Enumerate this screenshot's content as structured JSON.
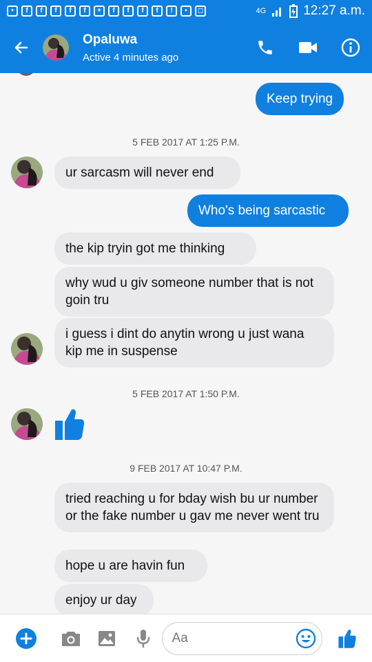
{
  "status_bar": {
    "network": "4G",
    "time": "12:27 a.m."
  },
  "header": {
    "name": "Opaluwa",
    "status": "Active 4 minutes ago"
  },
  "messages": [
    {
      "text": "Keep trying"
    },
    {
      "text": "ur sarcasm will never end"
    },
    {
      "text": "Who's being sarcastic"
    },
    {
      "text": "the kip tryin got me thinking"
    },
    {
      "text": "why wud u giv someone  number that is not goin tru"
    },
    {
      "text": "i guess i dint do anytin wrong u just wana kip me in suspense"
    },
    {
      "text": "tried reaching u for bday wish bu ur number or the fake number u gav me never went tru"
    },
    {
      "text": "hope u are havin fun"
    },
    {
      "text": "enjoy ur day"
    }
  ],
  "timestamps": [
    "5 FEB 2017 AT 1:25 P.M.",
    "5 FEB 2017 AT 1:50 P.M.",
    "9 FEB 2017 AT 10:47 P.M."
  ],
  "composer": {
    "placeholder": "Aa"
  },
  "colors": {
    "accent": "#0f80e0",
    "incoming_bubble": "#e9e9eb"
  },
  "icons": [
    "back-arrow-icon",
    "phone-icon",
    "video-icon",
    "info-icon",
    "plus-icon",
    "camera-icon",
    "image-icon",
    "mic-icon",
    "emoji-icon",
    "thumbs-up-icon"
  ]
}
